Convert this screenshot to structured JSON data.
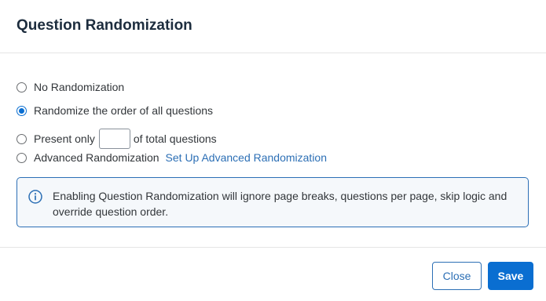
{
  "dialog": {
    "title": "Question Randomization"
  },
  "options": {
    "no_randomization": "No Randomization",
    "randomize_all": "Randomize the order of all questions",
    "present_only_prefix": "Present only",
    "present_only_value": "",
    "present_only_suffix": "of total questions",
    "advanced": "Advanced Randomization",
    "advanced_link": "Set Up Advanced Randomization",
    "selected": "randomize_all"
  },
  "info": {
    "icon": "info-circle-icon",
    "line1": "Enabling Question Randomization will ignore page breaks, questions per page, skip logic and",
    "line2": "override question order."
  },
  "footer": {
    "close_label": "Close",
    "save_label": "Save"
  },
  "colors": {
    "accent": "#0a6ed1",
    "link": "#2c6fb5",
    "info_bg": "#f5f8fb"
  }
}
